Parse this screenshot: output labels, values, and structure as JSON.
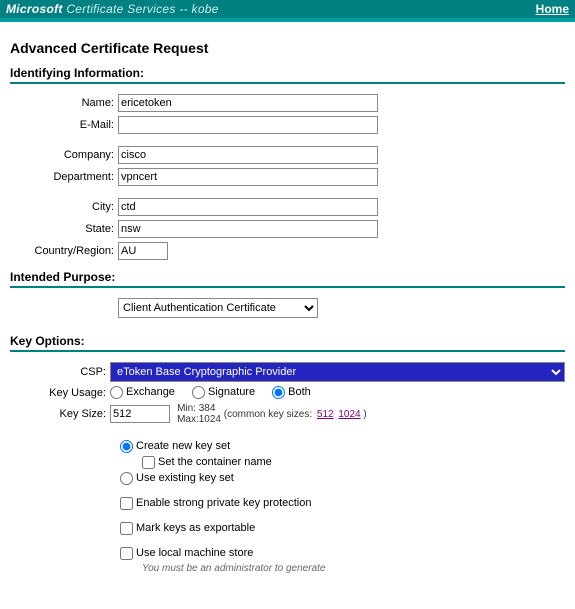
{
  "topbar": {
    "brand_bold": "Microsoft",
    "brand_rest": " Certificate Services  --  kobe",
    "home": "Home"
  },
  "page_title": "Advanced Certificate Request",
  "sections": {
    "identifying": "Identifying Information:",
    "purpose": "Intended Purpose:",
    "keyoptions": "Key Options:"
  },
  "labels": {
    "name": "Name:",
    "email": "E-Mail:",
    "company": "Company:",
    "department": "Department:",
    "city": "City:",
    "state": "State:",
    "country": "Country/Region:",
    "csp": "CSP:",
    "keyusage": "Key Usage:",
    "keysize": "Key Size:"
  },
  "values": {
    "name": "ericetoken",
    "email": "",
    "company": "cisco",
    "department": "vpncert",
    "city": "ctd",
    "state": "nsw",
    "country": "AU",
    "keysize": "512"
  },
  "purpose_selected": "Client Authentication Certificate",
  "csp_selected": "eToken Base Cryptographic Provider",
  "keyusage": {
    "exchange": "Exchange",
    "signature": "Signature",
    "both": "Both"
  },
  "keysize_meta": {
    "min": "Min:  384",
    "max": "Max:1024",
    "common_label": "(common key sizes:",
    "link512": "512",
    "link1024": "1024",
    "close": ")"
  },
  "keyset": {
    "create": "Create new key set",
    "container": "Set the container name",
    "existing": "Use existing key set",
    "strong": "Enable strong private key protection",
    "exportable": "Mark keys as exportable",
    "localstore": "Use local machine store",
    "localstore_hint": "You must be an administrator to generate"
  }
}
